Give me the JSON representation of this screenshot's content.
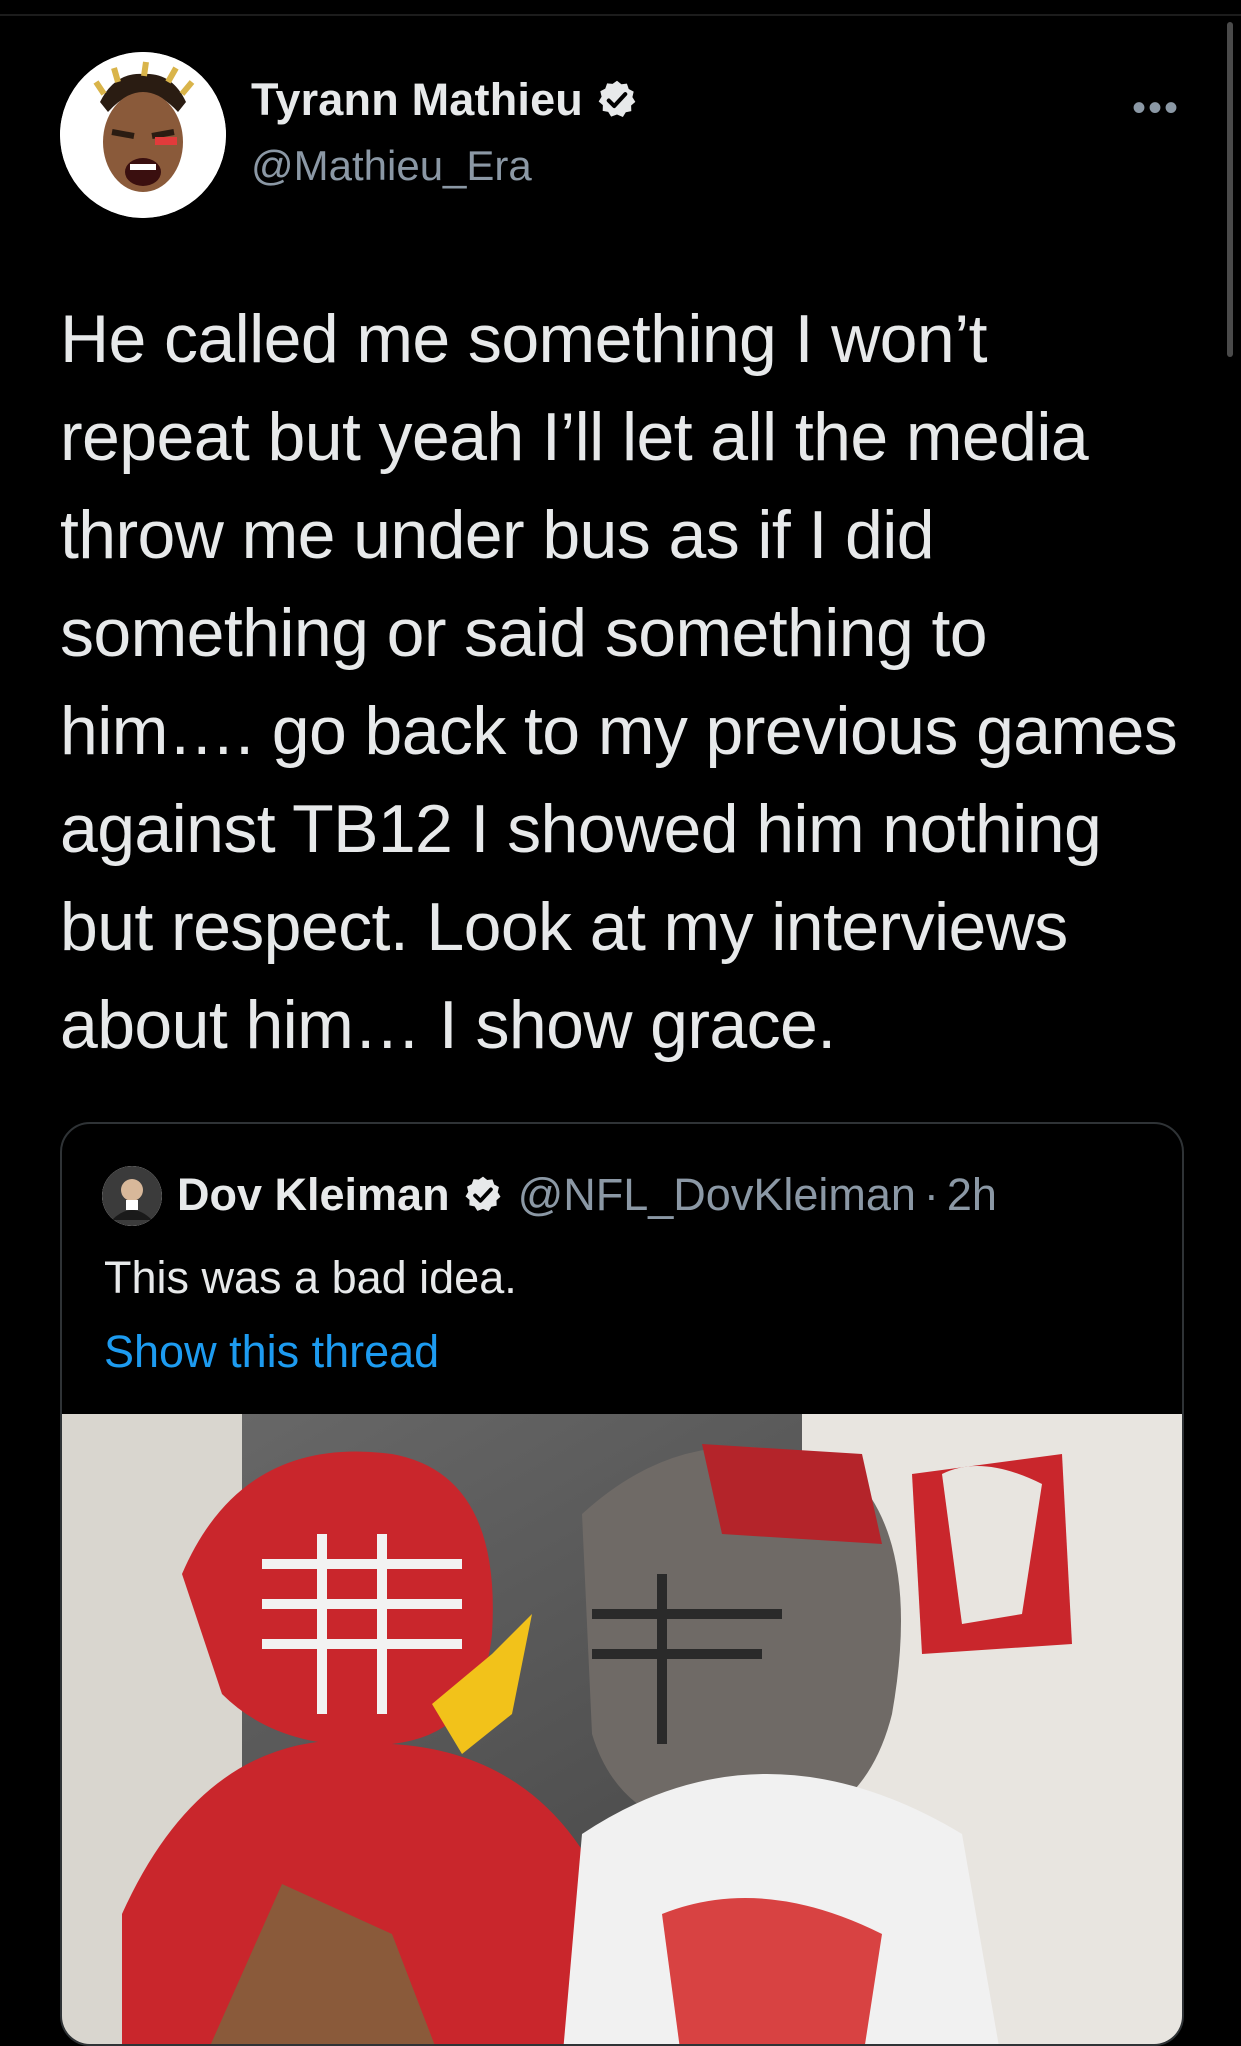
{
  "tweet": {
    "author_name": "Tyrann Mathieu",
    "author_handle": "@Mathieu_Era",
    "more_icon": "more-dots-icon",
    "text": "He called me something I won’t repeat but yeah I’ll let all the media throw me under bus as if I did something or said something to him…. go back to my previous games against TB12 I showed him nothing but respect. Look at my interviews about him… I show grace."
  },
  "quote": {
    "author_name": "Dov Kleiman",
    "author_handle": "@NFL_DovKleiman",
    "separator": "·",
    "time": "2h",
    "text": "This was a bad idea.",
    "thread_link": "Show this thread"
  },
  "colors": {
    "background": "#000000",
    "primary_text": "#e7e9ea",
    "secondary_text": "#8b98a5",
    "link": "#1d9bf0"
  }
}
